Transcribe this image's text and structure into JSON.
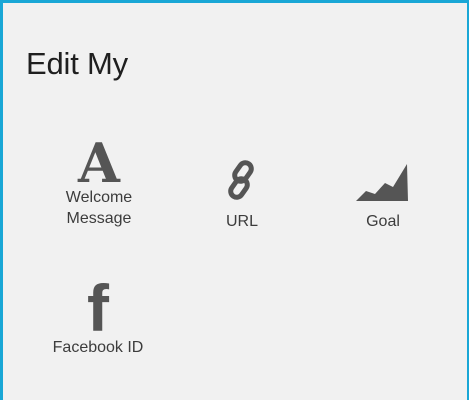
{
  "panel": {
    "title": "Edit My",
    "accent_color": "#1aa7d6",
    "background_color": "#f1f1f1",
    "icon_color": "#555555"
  },
  "tiles": [
    {
      "icon": "letter-a-icon",
      "glyph": "A",
      "label_line1": "Welcome",
      "label_line2": "Message"
    },
    {
      "icon": "link-icon",
      "label": "URL"
    },
    {
      "icon": "rising-area-chart-icon",
      "label": "Goal"
    },
    {
      "icon": "facebook-icon",
      "glyph": "f",
      "label": "Facebook ID"
    }
  ]
}
